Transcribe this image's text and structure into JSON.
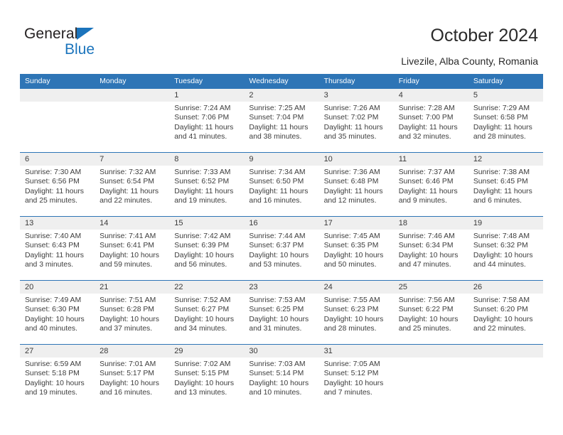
{
  "brand": {
    "name_dark": "General",
    "name_light": "Blue",
    "colors": {
      "blue": "#1b74bc",
      "dark": "#231f20"
    }
  },
  "header": {
    "title": "October 2024",
    "subtitle": "Livezile, Alba County, Romania"
  },
  "colors": {
    "header_bg": "#2e75b6",
    "header_text": "#ffffff",
    "date_band": "#efefef",
    "row_rule": "#2e75b6",
    "body_text": "#3d3d3d"
  },
  "calendar": {
    "weekday_headers": [
      "Sunday",
      "Monday",
      "Tuesday",
      "Wednesday",
      "Thursday",
      "Friday",
      "Saturday"
    ],
    "weeks": [
      [
        {
          "day": "",
          "lines": []
        },
        {
          "day": "",
          "lines": []
        },
        {
          "day": "1",
          "lines": [
            "Sunrise: 7:24 AM",
            "Sunset: 7:06 PM",
            "Daylight: 11 hours",
            "and 41 minutes."
          ]
        },
        {
          "day": "2",
          "lines": [
            "Sunrise: 7:25 AM",
            "Sunset: 7:04 PM",
            "Daylight: 11 hours",
            "and 38 minutes."
          ]
        },
        {
          "day": "3",
          "lines": [
            "Sunrise: 7:26 AM",
            "Sunset: 7:02 PM",
            "Daylight: 11 hours",
            "and 35 minutes."
          ]
        },
        {
          "day": "4",
          "lines": [
            "Sunrise: 7:28 AM",
            "Sunset: 7:00 PM",
            "Daylight: 11 hours",
            "and 32 minutes."
          ]
        },
        {
          "day": "5",
          "lines": [
            "Sunrise: 7:29 AM",
            "Sunset: 6:58 PM",
            "Daylight: 11 hours",
            "and 28 minutes."
          ]
        }
      ],
      [
        {
          "day": "6",
          "lines": [
            "Sunrise: 7:30 AM",
            "Sunset: 6:56 PM",
            "Daylight: 11 hours",
            "and 25 minutes."
          ]
        },
        {
          "day": "7",
          "lines": [
            "Sunrise: 7:32 AM",
            "Sunset: 6:54 PM",
            "Daylight: 11 hours",
            "and 22 minutes."
          ]
        },
        {
          "day": "8",
          "lines": [
            "Sunrise: 7:33 AM",
            "Sunset: 6:52 PM",
            "Daylight: 11 hours",
            "and 19 minutes."
          ]
        },
        {
          "day": "9",
          "lines": [
            "Sunrise: 7:34 AM",
            "Sunset: 6:50 PM",
            "Daylight: 11 hours",
            "and 16 minutes."
          ]
        },
        {
          "day": "10",
          "lines": [
            "Sunrise: 7:36 AM",
            "Sunset: 6:48 PM",
            "Daylight: 11 hours",
            "and 12 minutes."
          ]
        },
        {
          "day": "11",
          "lines": [
            "Sunrise: 7:37 AM",
            "Sunset: 6:46 PM",
            "Daylight: 11 hours",
            "and 9 minutes."
          ]
        },
        {
          "day": "12",
          "lines": [
            "Sunrise: 7:38 AM",
            "Sunset: 6:45 PM",
            "Daylight: 11 hours",
            "and 6 minutes."
          ]
        }
      ],
      [
        {
          "day": "13",
          "lines": [
            "Sunrise: 7:40 AM",
            "Sunset: 6:43 PM",
            "Daylight: 11 hours",
            "and 3 minutes."
          ]
        },
        {
          "day": "14",
          "lines": [
            "Sunrise: 7:41 AM",
            "Sunset: 6:41 PM",
            "Daylight: 10 hours",
            "and 59 minutes."
          ]
        },
        {
          "day": "15",
          "lines": [
            "Sunrise: 7:42 AM",
            "Sunset: 6:39 PM",
            "Daylight: 10 hours",
            "and 56 minutes."
          ]
        },
        {
          "day": "16",
          "lines": [
            "Sunrise: 7:44 AM",
            "Sunset: 6:37 PM",
            "Daylight: 10 hours",
            "and 53 minutes."
          ]
        },
        {
          "day": "17",
          "lines": [
            "Sunrise: 7:45 AM",
            "Sunset: 6:35 PM",
            "Daylight: 10 hours",
            "and 50 minutes."
          ]
        },
        {
          "day": "18",
          "lines": [
            "Sunrise: 7:46 AM",
            "Sunset: 6:34 PM",
            "Daylight: 10 hours",
            "and 47 minutes."
          ]
        },
        {
          "day": "19",
          "lines": [
            "Sunrise: 7:48 AM",
            "Sunset: 6:32 PM",
            "Daylight: 10 hours",
            "and 44 minutes."
          ]
        }
      ],
      [
        {
          "day": "20",
          "lines": [
            "Sunrise: 7:49 AM",
            "Sunset: 6:30 PM",
            "Daylight: 10 hours",
            "and 40 minutes."
          ]
        },
        {
          "day": "21",
          "lines": [
            "Sunrise: 7:51 AM",
            "Sunset: 6:28 PM",
            "Daylight: 10 hours",
            "and 37 minutes."
          ]
        },
        {
          "day": "22",
          "lines": [
            "Sunrise: 7:52 AM",
            "Sunset: 6:27 PM",
            "Daylight: 10 hours",
            "and 34 minutes."
          ]
        },
        {
          "day": "23",
          "lines": [
            "Sunrise: 7:53 AM",
            "Sunset: 6:25 PM",
            "Daylight: 10 hours",
            "and 31 minutes."
          ]
        },
        {
          "day": "24",
          "lines": [
            "Sunrise: 7:55 AM",
            "Sunset: 6:23 PM",
            "Daylight: 10 hours",
            "and 28 minutes."
          ]
        },
        {
          "day": "25",
          "lines": [
            "Sunrise: 7:56 AM",
            "Sunset: 6:22 PM",
            "Daylight: 10 hours",
            "and 25 minutes."
          ]
        },
        {
          "day": "26",
          "lines": [
            "Sunrise: 7:58 AM",
            "Sunset: 6:20 PM",
            "Daylight: 10 hours",
            "and 22 minutes."
          ]
        }
      ],
      [
        {
          "day": "27",
          "lines": [
            "Sunrise: 6:59 AM",
            "Sunset: 5:18 PM",
            "Daylight: 10 hours",
            "and 19 minutes."
          ]
        },
        {
          "day": "28",
          "lines": [
            "Sunrise: 7:01 AM",
            "Sunset: 5:17 PM",
            "Daylight: 10 hours",
            "and 16 minutes."
          ]
        },
        {
          "day": "29",
          "lines": [
            "Sunrise: 7:02 AM",
            "Sunset: 5:15 PM",
            "Daylight: 10 hours",
            "and 13 minutes."
          ]
        },
        {
          "day": "30",
          "lines": [
            "Sunrise: 7:03 AM",
            "Sunset: 5:14 PM",
            "Daylight: 10 hours",
            "and 10 minutes."
          ]
        },
        {
          "day": "31",
          "lines": [
            "Sunrise: 7:05 AM",
            "Sunset: 5:12 PM",
            "Daylight: 10 hours",
            "and 7 minutes."
          ]
        },
        {
          "day": "",
          "lines": []
        },
        {
          "day": "",
          "lines": []
        }
      ]
    ]
  }
}
